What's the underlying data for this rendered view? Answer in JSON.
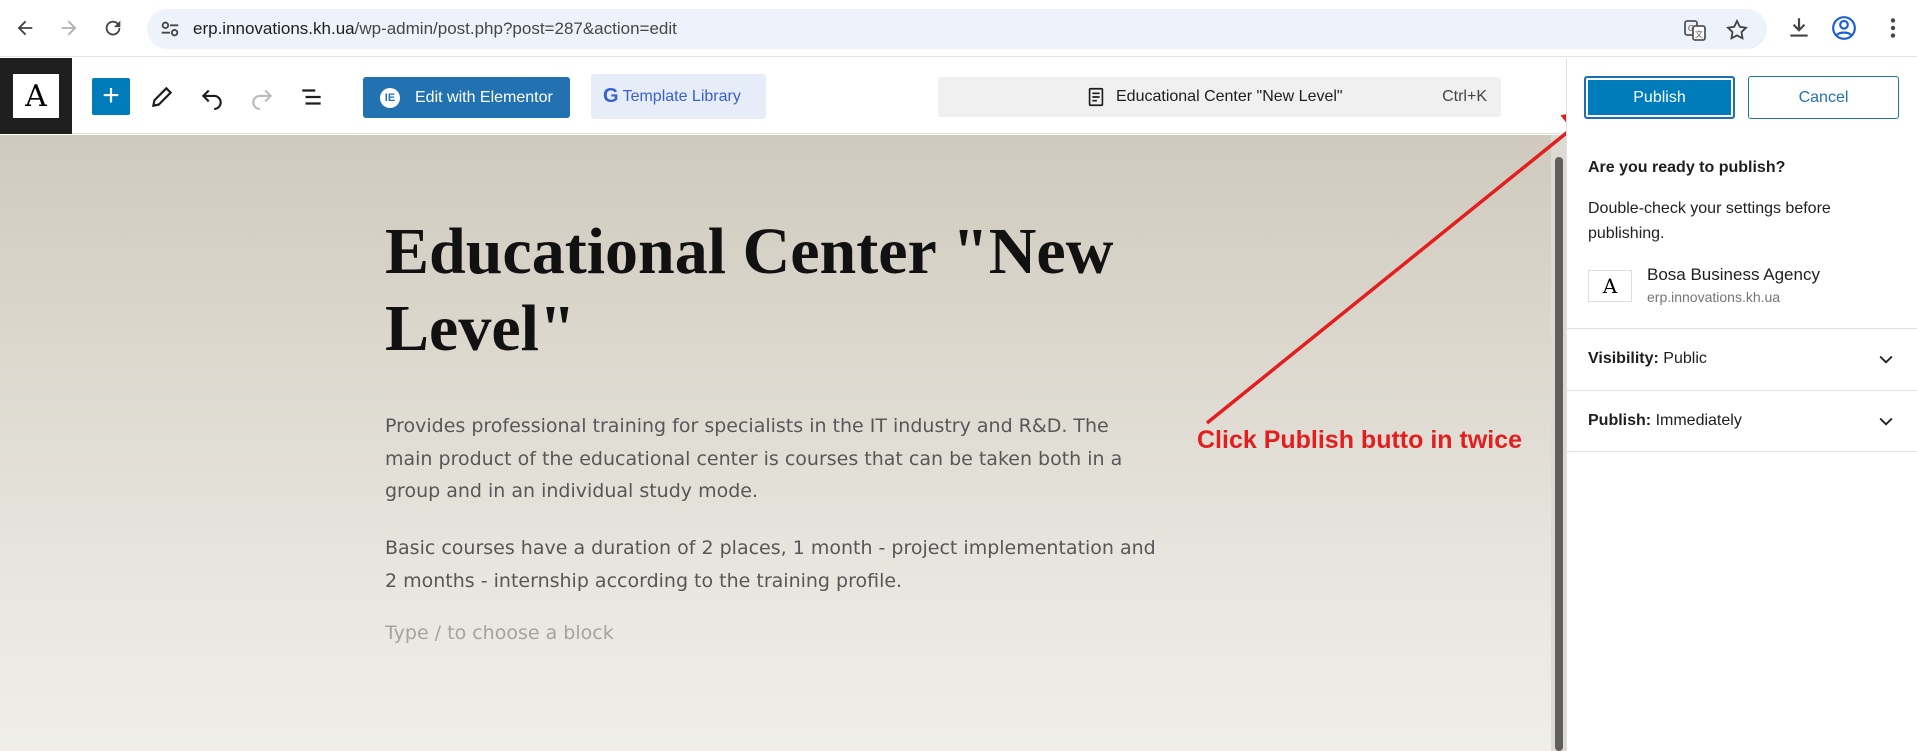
{
  "browser": {
    "url_host": "erp.innovations.kh.ua",
    "url_path": "/wp-admin/post.php?post=287&action=edit"
  },
  "toolbar": {
    "add_label": "+",
    "elementor_label": "Edit with Elementor",
    "template_library_label": "Template Library",
    "command_title": "Educational Center \"New Level\"",
    "command_shortcut": "Ctrl+K"
  },
  "post": {
    "title": "Educational Center \"New Level\"",
    "paragraphs": [
      "Provides professional training for specialists in the IT industry and R&D. The main product of the educational center is courses that can be taken both in a group and in an individual study mode.",
      "Basic courses have a duration of 2 places, 1 month - project implementation and 2 months - internship according to the training profile."
    ],
    "block_placeholder": "Type / to choose a block"
  },
  "annotation": {
    "text": "Click Publish butto in twice",
    "color": "#e31e1e"
  },
  "publish_panel": {
    "publish_label": "Publish",
    "cancel_label": "Cancel",
    "ready_title": "Are you ready to publish?",
    "ready_desc": "Double-check your settings before publishing.",
    "site_name": "Bosa Business Agency",
    "site_url": "erp.innovations.kh.ua",
    "visibility_label": "Visibility:",
    "visibility_value": "Public",
    "publish_time_label": "Publish:",
    "publish_time_value": "Immediately"
  },
  "colors": {
    "wp_blue": "#007cba",
    "elementor_blue": "#2271b1",
    "annotation_red": "#e31e1e"
  }
}
